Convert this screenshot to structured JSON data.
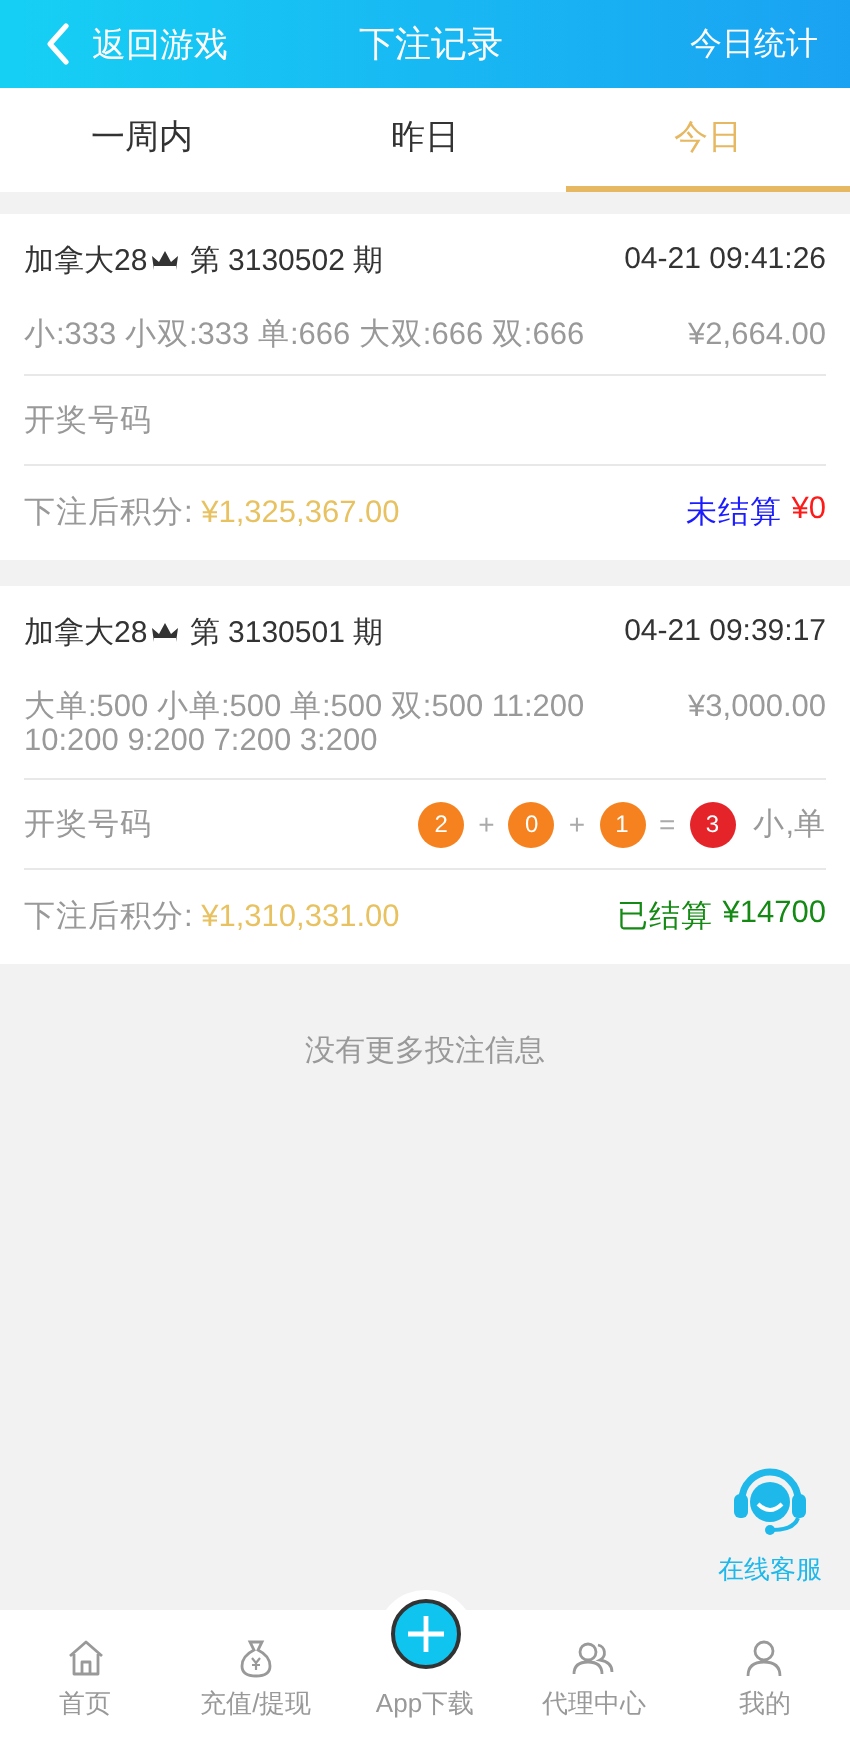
{
  "header": {
    "back": "返回游戏",
    "title": "下注记录",
    "action": "今日统计"
  },
  "tabs": [
    {
      "label": "一周内",
      "selected": false
    },
    {
      "label": "昨日",
      "selected": false
    },
    {
      "label": "今日",
      "selected": true
    }
  ],
  "bets": [
    {
      "game": "加拿大28",
      "period": "第 3130502 期",
      "time": "04-21 09:41:26",
      "detail": "小:333 小双:333 单:666 大双:666 双:666",
      "amount": "¥2,664.00",
      "result_label": "开奖号码",
      "balance_label": "下注后积分:",
      "balance": "¥1,325,367.00",
      "settled": false,
      "status": "未结算",
      "payout": "¥0"
    },
    {
      "game": "加拿大28",
      "period": "第 3130501 期",
      "time": "04-21 09:39:17",
      "detail": "大单:500 小单:500 单:500 双:500 11:200 10:200 9:200 7:200 3:200",
      "amount": "¥3,000.00",
      "result_label": "开奖号码",
      "result": [
        {
          "kind": "ball",
          "text": "2"
        },
        {
          "kind": "op",
          "text": "+"
        },
        {
          "kind": "ball",
          "text": "0"
        },
        {
          "kind": "op",
          "text": "+"
        },
        {
          "kind": "ball",
          "text": "1"
        },
        {
          "kind": "op",
          "text": "="
        },
        {
          "kind": "sum",
          "text": "3"
        }
      ],
      "result_text": "小,单",
      "balance_label": "下注后积分:",
      "balance": "¥1,310,331.00",
      "settled": true,
      "status": "已结算",
      "payout": "¥14700"
    }
  ],
  "end_note": "没有更多投注信息",
  "service": {
    "label": "在线客服"
  },
  "nav": [
    {
      "kind": "home",
      "label": "首页"
    },
    {
      "kind": "bag",
      "label": "充值/提现"
    },
    {
      "kind": "plus",
      "label": "App下载"
    },
    {
      "kind": "people",
      "label": "代理中心"
    },
    {
      "kind": "person",
      "label": "我的"
    }
  ]
}
